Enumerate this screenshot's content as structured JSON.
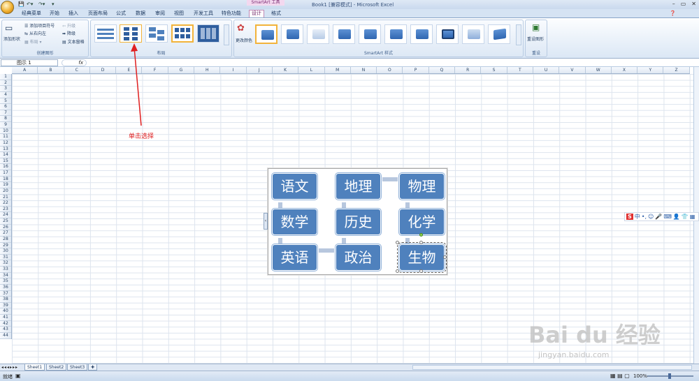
{
  "app": {
    "window_title": "Book1  [兼容模式] - Microsoft Excel",
    "contextual_tool": "SmartArt 工具"
  },
  "tabs": [
    "经典菜单",
    "开始",
    "插入",
    "页面布局",
    "公式",
    "数据",
    "审阅",
    "视图",
    "开发工具",
    "特色功能",
    "设计",
    "格式"
  ],
  "active_tab": "设计",
  "ribbon": {
    "create_graphic": {
      "label": "创建图形",
      "add_shape": "添加形状",
      "add_bullet": "添加项目符号",
      "right_to_left": "从右向左",
      "layout": "布局",
      "promote": "升级",
      "demote": "降级",
      "text_pane": "文本窗格"
    },
    "layouts": {
      "label": "布局"
    },
    "styles": {
      "label": "SmartArt 样式",
      "change_colors": "更改颜色"
    },
    "reset": {
      "label": "重设",
      "reset_graphic": "重设图形"
    }
  },
  "formula_bar": {
    "name_box": "图示 1",
    "fx": "fx"
  },
  "columns": [
    "A",
    "B",
    "C",
    "D",
    "E",
    "F",
    "G",
    "H",
    "I",
    "J",
    "K",
    "L",
    "M",
    "N",
    "O",
    "P",
    "Q",
    "R",
    "S",
    "T",
    "U",
    "V",
    "W",
    "X",
    "Y",
    "Z"
  ],
  "rows": [
    "1",
    "2",
    "3",
    "4",
    "5",
    "6",
    "7",
    "8",
    "9",
    "10",
    "11",
    "12",
    "13",
    "14",
    "15",
    "16",
    "17",
    "18",
    "19",
    "20",
    "21",
    "22",
    "23",
    "24",
    "25",
    "26",
    "27",
    "28",
    "29",
    "30",
    "31",
    "32",
    "33",
    "34",
    "35",
    "36",
    "37",
    "38",
    "39",
    "40",
    "41",
    "42",
    "43",
    "44"
  ],
  "smartart": {
    "nodes": [
      {
        "text": "语文"
      },
      {
        "text": "地理"
      },
      {
        "text": "物理"
      },
      {
        "text": "数学"
      },
      {
        "text": "历史"
      },
      {
        "text": "化学"
      },
      {
        "text": "英语"
      },
      {
        "text": "政治"
      },
      {
        "text": "生物"
      }
    ]
  },
  "annotation": {
    "text": "单击选择",
    "color": "#e02020"
  },
  "sheets": [
    "Sheet1",
    "Sheet2",
    "Sheet3"
  ],
  "status": {
    "ready": "就绪",
    "zoom": "100%"
  },
  "watermark": {
    "brand": "Bai du 经验",
    "url": "jingyan.baidu.com"
  },
  "colors": {
    "node_fill": "#4f81bd",
    "ribbon_bg": "#dbe7f5",
    "selection": "#f2b33a"
  }
}
